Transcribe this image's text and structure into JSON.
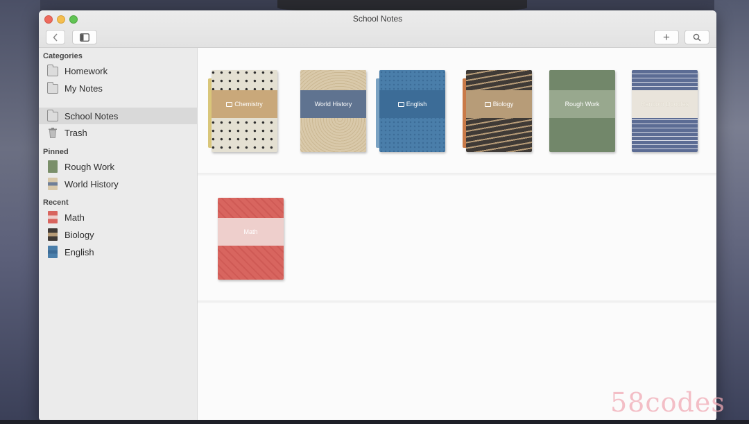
{
  "window": {
    "title": "School Notes"
  },
  "toolbar": {
    "back_icon": "chevron-left-icon",
    "sidebar_icon": "sidebar-toggle-icon",
    "add_label": "+",
    "search_icon": "search-icon"
  },
  "sidebar": {
    "sections": [
      {
        "title": "Categories",
        "items": [
          {
            "label": "Homework",
            "icon": "folder-icon"
          },
          {
            "label": "My Notes",
            "icon": "folder-icon"
          },
          {
            "label": "School Notes",
            "icon": "folder-icon",
            "selected": true
          },
          {
            "label": "Trash",
            "icon": "trash-icon"
          }
        ]
      },
      {
        "title": "Pinned",
        "items": [
          {
            "label": "Rough Work",
            "icon": "notebook-icon",
            "color": "#7a8f6a"
          },
          {
            "label": "World History",
            "icon": "notebook-icon",
            "color": "#6f7f98"
          }
        ]
      },
      {
        "title": "Recent",
        "items": [
          {
            "label": "Math",
            "icon": "notebook-icon",
            "color": "#d8655f"
          },
          {
            "label": "Biology",
            "icon": "notebook-icon",
            "color": "#8a7a60"
          },
          {
            "label": "English",
            "icon": "notebook-icon",
            "color": "#4f7ea6"
          }
        ]
      }
    ]
  },
  "notebooks": [
    {
      "label": "Chemistry",
      "folder": true,
      "cover": "#e4e0d2",
      "band": "#c9a87a",
      "tab": "#d9c67a"
    },
    {
      "label": "World History",
      "folder": false,
      "cover": "#d9c9aa",
      "band": "#5f7390",
      "tab": null
    },
    {
      "label": "English",
      "folder": true,
      "cover": "#4a7eaa",
      "band": "#3c6c97",
      "tab": "#7aa2c2"
    },
    {
      "label": "Biology",
      "folder": true,
      "cover": "#3f3a36",
      "band": "#b79c78",
      "tab": "#c97a48"
    },
    {
      "label": "Rough Work",
      "folder": false,
      "cover": "#72876a",
      "band": "#98a88e",
      "tab": null
    },
    {
      "label": "Random Doodles",
      "folder": false,
      "cover": "#5c6c94",
      "band": "#e9e4db",
      "tab": null
    },
    {
      "label": "Math",
      "folder": false,
      "cover": "#d8655f",
      "band": "#eecfcc",
      "tab": null
    }
  ],
  "watermark": "58codes"
}
